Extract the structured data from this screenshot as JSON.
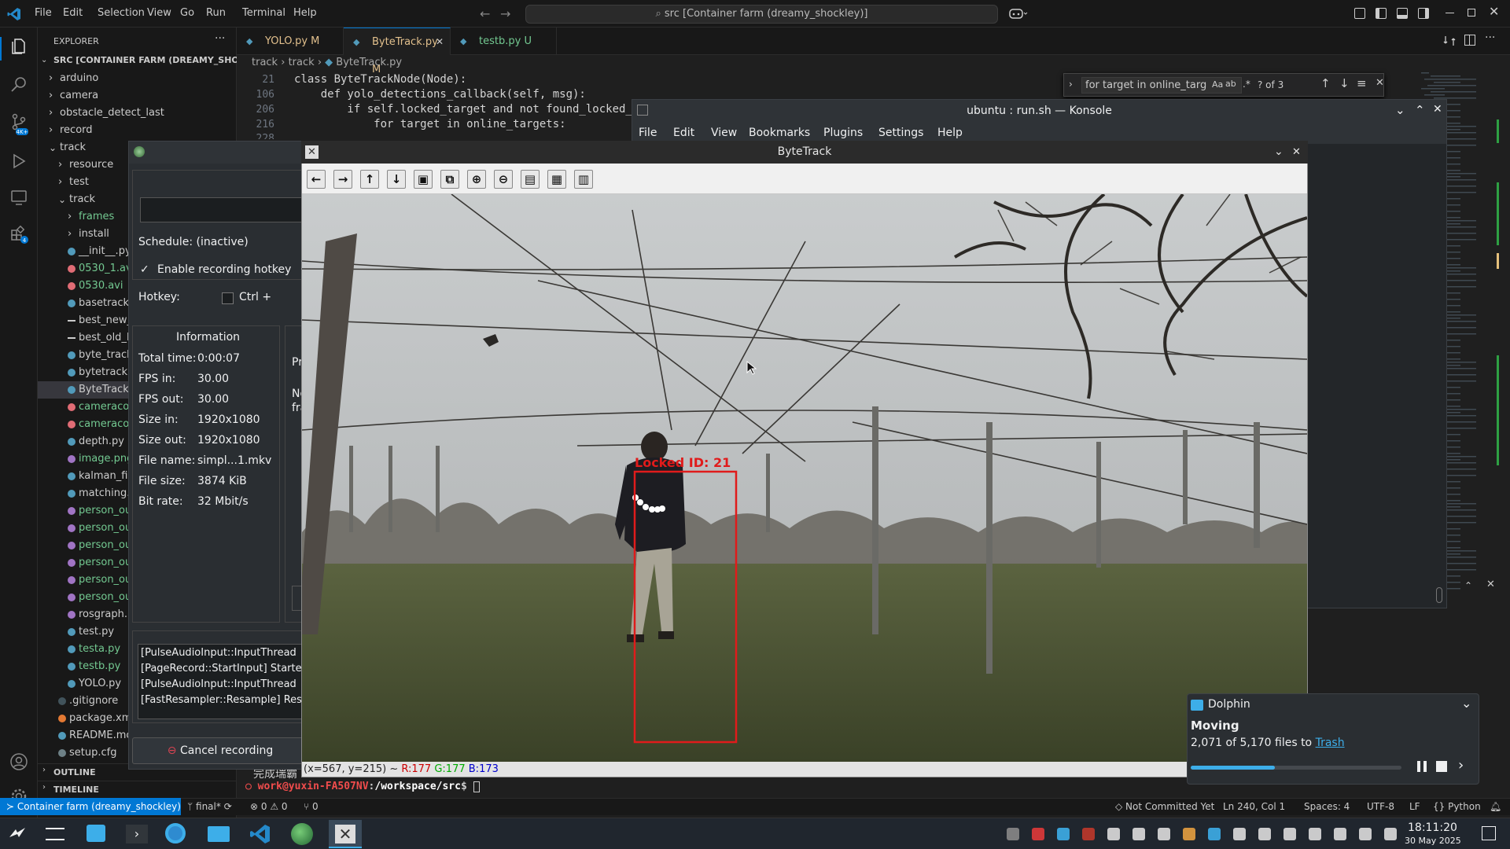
{
  "vscode": {
    "menu": [
      "File",
      "Edit",
      "Selection",
      "View",
      "Go",
      "Run",
      "Terminal",
      "Help"
    ],
    "command_center": "src [Container farm (dreamy_shockley)]",
    "explorer_title": "EXPLORER",
    "root": "SRC [CONTAINER FARM (DREAMY_SHOCK...",
    "tree": [
      {
        "label": "arduino",
        "kind": "folder",
        "indent": 1,
        "open": false
      },
      {
        "label": "camera",
        "kind": "folder",
        "indent": 1,
        "open": false
      },
      {
        "label": "obstacle_detect_last",
        "kind": "folder",
        "indent": 1,
        "open": false
      },
      {
        "label": "record",
        "kind": "folder",
        "indent": 1,
        "open": false
      },
      {
        "label": "track",
        "kind": "folder",
        "indent": 1,
        "open": true
      },
      {
        "label": "resource",
        "kind": "folder",
        "indent": 2,
        "open": false
      },
      {
        "label": "test",
        "kind": "folder",
        "indent": 2,
        "open": false
      },
      {
        "label": "track",
        "kind": "folder",
        "indent": 2,
        "open": true
      },
      {
        "label": "frames",
        "kind": "folder",
        "indent": 3,
        "open": false,
        "color": "#73c991"
      },
      {
        "label": "install",
        "kind": "folder",
        "indent": 3,
        "open": false
      },
      {
        "label": "__init__.py",
        "kind": "py",
        "indent": 3
      },
      {
        "label": "0530_1.avi",
        "kind": "avi",
        "indent": 3,
        "color": "#73c991"
      },
      {
        "label": "0530.avi",
        "kind": "avi",
        "indent": 3,
        "color": "#73c991"
      },
      {
        "label": "basetrack.",
        "kind": "py",
        "indent": 3
      },
      {
        "label": "best_new_",
        "kind": "txt",
        "indent": 3
      },
      {
        "label": "best_old_l",
        "kind": "txt",
        "indent": 3
      },
      {
        "label": "byte_track",
        "kind": "py",
        "indent": 3
      },
      {
        "label": "bytetrack.p",
        "kind": "py",
        "indent": 3
      },
      {
        "label": "ByteTrack.",
        "kind": "py",
        "indent": 3,
        "selected": true
      },
      {
        "label": "cameracol",
        "kind": "avi",
        "indent": 3,
        "color": "#73c991"
      },
      {
        "label": "cameracol",
        "kind": "avi",
        "indent": 3,
        "color": "#73c991"
      },
      {
        "label": "depth.py",
        "kind": "py",
        "indent": 3
      },
      {
        "label": "image.png",
        "kind": "img",
        "indent": 3,
        "color": "#73c991"
      },
      {
        "label": "kalman_filt",
        "kind": "py",
        "indent": 3
      },
      {
        "label": "matching.p",
        "kind": "py",
        "indent": 3
      },
      {
        "label": "person_ou",
        "kind": "img",
        "indent": 3,
        "color": "#73c991"
      },
      {
        "label": "person_ou",
        "kind": "img",
        "indent": 3,
        "color": "#73c991"
      },
      {
        "label": "person_ou",
        "kind": "img",
        "indent": 3,
        "color": "#73c991"
      },
      {
        "label": "person_ou",
        "kind": "img",
        "indent": 3,
        "color": "#73c991"
      },
      {
        "label": "person_ou",
        "kind": "img",
        "indent": 3,
        "color": "#73c991"
      },
      {
        "label": "person_ou",
        "kind": "img",
        "indent": 3,
        "color": "#73c991"
      },
      {
        "label": "rosgraph.p",
        "kind": "img",
        "indent": 3
      },
      {
        "label": "test.py",
        "kind": "py",
        "indent": 3
      },
      {
        "label": "testa.py",
        "kind": "py",
        "indent": 3,
        "color": "#73c991"
      },
      {
        "label": "testb.py",
        "kind": "py",
        "indent": 3,
        "color": "#73c991"
      },
      {
        "label": "YOLO.py",
        "kind": "py",
        "indent": 3
      },
      {
        "label": ".gitignore",
        "kind": "git",
        "indent": 2
      },
      {
        "label": "package.xm",
        "kind": "xml",
        "indent": 2
      },
      {
        "label": "README.mc",
        "kind": "md",
        "indent": 2
      },
      {
        "label": "setup.cfg",
        "kind": "cfg",
        "indent": 2
      }
    ],
    "outline": "OUTLINE",
    "timeline": "TIMELINE",
    "tabs": [
      {
        "label": "YOLO.py",
        "badge": "M",
        "active": false
      },
      {
        "label": "ByteTrack.py",
        "badge": "M",
        "active": true
      },
      {
        "label": "testb.py",
        "badge": "U",
        "active": false
      }
    ],
    "breadcrumb": [
      "track",
      "track",
      "ByteTrack.py"
    ],
    "sticky_lines": [
      {
        "num": "21",
        "code": "class ByteTrackNode(Node):"
      },
      {
        "num": "106",
        "code": "    def yolo_detections_callback(self, msg):"
      },
      {
        "num": "206",
        "code": "        if self.locked_target and not found_locked_"
      },
      {
        "num": "216",
        "code": "            for target in online_targets:"
      }
    ],
    "find": {
      "query": "for target in online_targ",
      "count": "? of 3"
    },
    "terminal": {
      "prompt_user": "work@yuxin-FA507NV",
      "prompt_path": "/workspace/src",
      "cjk": "完成瑞霸"
    },
    "status": {
      "remote": "Container farm (dreamy_shockley)",
      "branch": "final*",
      "errors": "0",
      "warnings": "0",
      "ports": "0",
      "not_committed": "Not Committed Yet",
      "cursor": "Ln 240, Col 1",
      "spaces": "Spaces: 4",
      "encoding": "UTF-8",
      "eol": "LF",
      "lang": "Python"
    }
  },
  "konsole": {
    "title": "ubuntu : run.sh — Konsole",
    "menu": [
      "File",
      "Edit",
      "View",
      "Bookmarks",
      "Plugins",
      "Settings",
      "Help"
    ]
  },
  "recorder": {
    "schedule": "Schedule: (inactive)",
    "hotkey_enable": "Enable recording hotkey",
    "hotkey_label": "Hotkey:",
    "hotkey_mod": "Ctrl +",
    "info_title": "Information",
    "info": [
      {
        "k": "Total time:",
        "v": "0:00:07"
      },
      {
        "k": "FPS in:",
        "v": "30.00"
      },
      {
        "k": "FPS out:",
        "v": "30.00"
      },
      {
        "k": "Size in:",
        "v": "1920x1080"
      },
      {
        "k": "Size out:",
        "v": "1920x1080"
      },
      {
        "k": "File name:",
        "v": "simpl...1.mkv"
      },
      {
        "k": "File size:",
        "v": "3874 KiB"
      },
      {
        "k": "Bit rate:",
        "v": "32 Mbit/s"
      }
    ],
    "side_labels": [
      "Pr",
      "No",
      "fra"
    ],
    "log": [
      "[PulseAudioInput::InputThread",
      "[PageRecord::StartInput] Starte",
      "[PulseAudioInput::InputThread",
      "[FastResampler::Resample] Res"
    ],
    "cancel": "Cancel recording"
  },
  "bytetrack": {
    "title": "ByteTrack",
    "toolbar": [
      "arrow-left-icon",
      "arrow-right-icon",
      "arrow-up-icon",
      "arrow-down-icon",
      "zoom-rect-icon",
      "image-fit-icon",
      "zoom-in-icon",
      "zoom-out-icon",
      "save-icon",
      "clipboard-icon",
      "pin-icon"
    ],
    "box_label": "Locked ID: 21",
    "status": {
      "coords": "(x=567, y=215) ~",
      "r": "R:177",
      "g": "G:177",
      "b": "B:173"
    }
  },
  "dolphin": {
    "app": "Dolphin",
    "title": "Moving",
    "detail": "2,071 of 5,170 files to",
    "link": "Trash",
    "progress": 0.4
  },
  "taskbar": {
    "time": "18:11:20",
    "date": "30 May 2025"
  }
}
